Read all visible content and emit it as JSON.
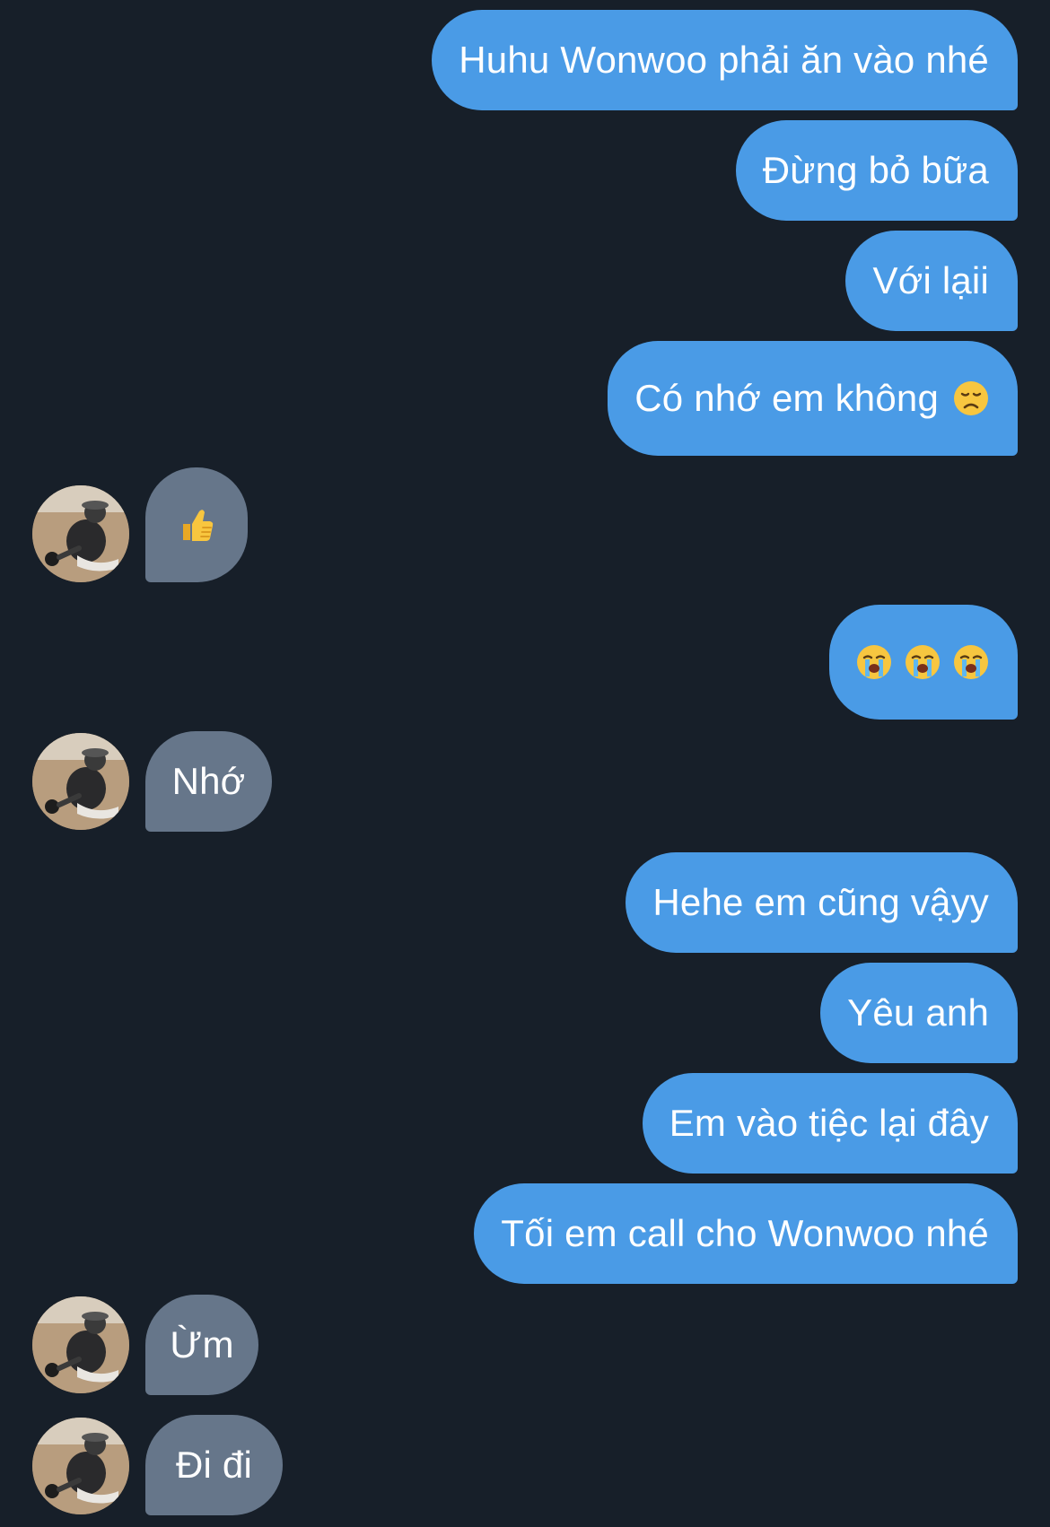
{
  "conversation": {
    "contact_avatar": "contact-avatar",
    "colors": {
      "background": "#171f29",
      "outgoing_bubble": "#4a9be6",
      "incoming_bubble": "#66768a",
      "text": "#ffffff"
    },
    "messages": [
      {
        "direction": "outgoing",
        "text": "Huhu Wonwoo phải ăn vào nhé"
      },
      {
        "direction": "outgoing",
        "text": "Đừng bỏ bữa"
      },
      {
        "direction": "outgoing",
        "text": "Với lạii"
      },
      {
        "direction": "outgoing",
        "text": "Có nhớ em không",
        "emoji": "disappointed-face-icon"
      },
      {
        "direction": "incoming",
        "emoji": "thumbs-up-icon"
      },
      {
        "direction": "outgoing",
        "emoji": [
          "loudly-crying-face-icon",
          "loudly-crying-face-icon",
          "loudly-crying-face-icon"
        ]
      },
      {
        "direction": "incoming",
        "text": "Nhớ"
      },
      {
        "direction": "outgoing",
        "text": "Hehe em cũng vậyy"
      },
      {
        "direction": "outgoing",
        "text": "Yêu anh"
      },
      {
        "direction": "outgoing",
        "text": "Em vào tiệc lại đây"
      },
      {
        "direction": "outgoing",
        "text": "Tối em call cho Wonwoo nhé"
      },
      {
        "direction": "incoming",
        "text": "Ừm"
      },
      {
        "direction": "incoming",
        "text": "Đi đi"
      }
    ]
  }
}
